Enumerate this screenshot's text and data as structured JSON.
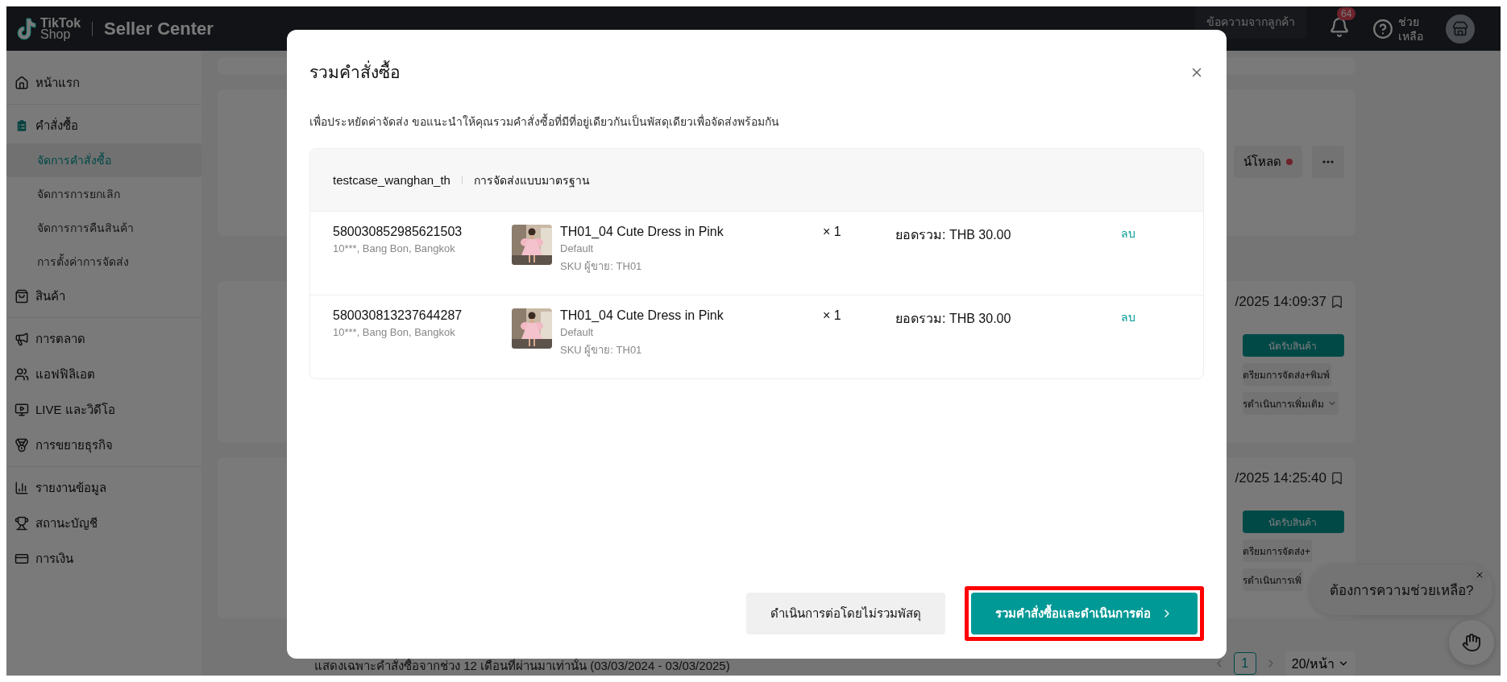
{
  "header": {
    "logo_top": "TikTok",
    "logo_bottom": "Shop",
    "title": "Seller Center",
    "messages_button": "ข้อความจากลูกค้า",
    "notifications_badge": "64",
    "help_label": [
      "ช่วย",
      "เหลือ"
    ]
  },
  "sidebar": {
    "groups": [
      [
        {
          "label": "หน้าแรก",
          "selected": false
        }
      ],
      [
        {
          "label": "คำสั่งซื้อ",
          "selected": false,
          "children": [
            {
              "label": "จัดการคำสั่งซื้อ",
              "selected": true
            },
            {
              "label": "จัดการการยกเลิก",
              "selected": false
            },
            {
              "label": "จัดการการคืนสินค้า",
              "selected": false
            },
            {
              "label": "การตั้งค่าการจัดส่ง",
              "selected": false
            }
          ]
        },
        {
          "label": "สินค้า",
          "selected": false
        }
      ],
      [
        {
          "label": "การตลาด",
          "selected": false
        },
        {
          "label": "แอฟฟิลิเอต",
          "selected": false
        },
        {
          "label": "LIVE และวิดีโอ",
          "selected": false
        },
        {
          "label": "การขยายธุรกิจ",
          "selected": false
        }
      ],
      [
        {
          "label": "รายงานข้อมูล",
          "selected": false
        },
        {
          "label": "สถานะบัญชี",
          "selected": false
        },
        {
          "label": "การเงิน",
          "selected": false
        }
      ]
    ]
  },
  "background": {
    "download_button": "น์โหลด",
    "orders": [
      {
        "time": "/2025 14:09:37",
        "actions": [
          "นัดรับสินค้า",
          "ตรียมการจัดส่ง+พิมพ์",
          "รดำเนินการเพิ่มเติม"
        ]
      },
      {
        "time": "/2025 14:25:40",
        "actions": [
          "นัดรับสินค้า",
          "ตรียมการจัดส่ง+",
          "รดำเนินการเพิ่"
        ]
      }
    ],
    "footer_note": "แสดงเฉพาะคำสั่งซื้อจากช่วง 12 เดือนที่ผ่านมาเท่านั้น (03/03/2024 - 03/03/2025)",
    "pagination": {
      "pages": [
        {
          "label": "1",
          "selected": true
        }
      ],
      "page_size": "20/หน้า"
    },
    "help_bubble": "ต้องการความช่วยเหลือ?"
  },
  "modal": {
    "title": "รวมคำสั่งซื้อ",
    "description": "เพื่อประหยัดค่าจัดส่ง ขอแนะนำให้คุณรวมคำสั่งซื้อที่มีที่อยู่เดียวกันเป็นพัสดุเดียวเพื่อจัดส่งพร้อมกัน",
    "group": {
      "shop": "testcase_wanghan_th",
      "shipping": "การจัดส่งแบบมาตรฐาน"
    },
    "orders": [
      {
        "order_id": "580030852985621503",
        "address": "10***, Bang Bon, Bangkok",
        "product": "TH01_04 Cute Dress in Pink",
        "variant": "Default",
        "sku": "SKU ผู้ขาย: TH01",
        "quantity": "× 1",
        "total": "ยอดรวม: THB 30.00",
        "remove": "ลบ"
      },
      {
        "order_id": "580030813237644287",
        "address": "10***, Bang Bon, Bangkok",
        "product": "TH01_04 Cute Dress in Pink",
        "variant": "Default",
        "sku": "SKU ผู้ขาย: TH01",
        "quantity": "× 1",
        "total": "ยอดรวม: THB 30.00",
        "remove": "ลบ"
      }
    ],
    "buttons": [
      {
        "label": "ดำเนินการต่อโดยไม่รวมพัสดุ",
        "kind": "secondary",
        "highlighted": false
      },
      {
        "label": "รวมคำสั่งซื้อและดำเนินการต่อ",
        "kind": "primary",
        "highlighted": true
      }
    ]
  }
}
